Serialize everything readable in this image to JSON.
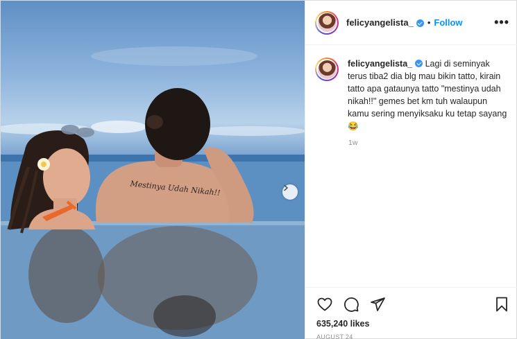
{
  "post": {
    "username": "felicyangelista_",
    "verified": true,
    "follow_label": "Follow",
    "separator": "•",
    "more_options_icon": "more-horizontal-icon",
    "tattoo_text": "Mestinya Udah Nikah!!",
    "caption": {
      "username": "felicyangelista_",
      "text": "Lagi di seminyak terus tiba2 dia blg mau bikin tatto, kirain tatto apa gataunya tatto \"mestinya udah nikah!!\" gemes bet km tuh walaupun kamu sering menyiksaku ku tetap sayang 😂",
      "time": "1w"
    },
    "actions": {
      "like_icon": "heart-icon",
      "comment_icon": "comment-icon",
      "share_icon": "send-icon",
      "save_icon": "bookmark-icon"
    },
    "likes": "635,240 likes",
    "date": "AUGUST 24",
    "colors": {
      "link_blue": "#0095f6",
      "verified_blue": "#3897f0",
      "muted_text": "#8e8e8e"
    }
  }
}
